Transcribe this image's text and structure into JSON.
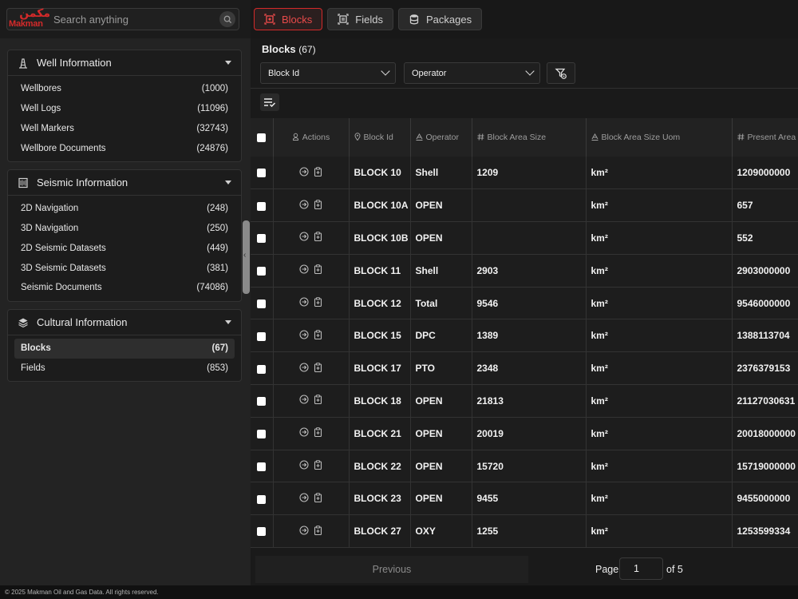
{
  "brand": {
    "logo_ar": "مكمن",
    "logo_en": "Makman"
  },
  "search": {
    "placeholder": "Search anything"
  },
  "tabs": [
    {
      "label": "Blocks",
      "icon": "block-icon",
      "active": true
    },
    {
      "label": "Fields",
      "icon": "fields-icon",
      "active": false
    },
    {
      "label": "Packages",
      "icon": "database-icon",
      "active": false
    }
  ],
  "sidebar": {
    "well": {
      "title": "Well Information",
      "items": [
        {
          "label": "Wellbores",
          "count": "(1000)"
        },
        {
          "label": "Well Logs",
          "count": "(11096)"
        },
        {
          "label": "Well Markers",
          "count": "(32743)"
        },
        {
          "label": "Wellbore Documents",
          "count": "(24876)"
        }
      ]
    },
    "seismic": {
      "title": "Seismic Information",
      "items": [
        {
          "label": "2D Navigation",
          "count": "(248)"
        },
        {
          "label": "3D Navigation",
          "count": "(250)"
        },
        {
          "label": "2D Seismic Datasets",
          "count": "(449)"
        },
        {
          "label": "3D Seismic Datasets",
          "count": "(381)"
        },
        {
          "label": "Seismic Documents",
          "count": "(74086)"
        }
      ]
    },
    "cultural": {
      "title": "Cultural Information",
      "items": [
        {
          "label": "Blocks",
          "count": "(67)",
          "active": true
        },
        {
          "label": "Fields",
          "count": "(853)"
        }
      ]
    }
  },
  "main": {
    "title": "Blocks",
    "count": "(67)",
    "filters": {
      "block_id": "Block Id",
      "operator": "Operator"
    }
  },
  "table": {
    "headers": {
      "actions": "Actions",
      "block_id": "Block Id",
      "operator": "Operator",
      "block_area_size": "Block Area Size",
      "block_area_size_uom": "Block Area Size Uom",
      "present_area_size": "Present Area Si"
    },
    "rows": [
      {
        "block_id": "BLOCK 10",
        "operator": "Shell",
        "area": "1209",
        "uom": "km²",
        "present": "1209000000"
      },
      {
        "block_id": "BLOCK 10A",
        "operator": "OPEN",
        "area": "",
        "uom": "km²",
        "present": "657"
      },
      {
        "block_id": "BLOCK 10B",
        "operator": "OPEN",
        "area": "",
        "uom": "km²",
        "present": "552"
      },
      {
        "block_id": "BLOCK 11",
        "operator": "Shell",
        "area": "2903",
        "uom": "km²",
        "present": "2903000000"
      },
      {
        "block_id": "BLOCK 12",
        "operator": "Total",
        "area": "9546",
        "uom": "km²",
        "present": "9546000000"
      },
      {
        "block_id": "BLOCK 15",
        "operator": "DPC",
        "area": "1389",
        "uom": "km²",
        "present": "1388113704"
      },
      {
        "block_id": "BLOCK 17",
        "operator": "PTO",
        "area": "2348",
        "uom": "km²",
        "present": "2376379153"
      },
      {
        "block_id": "BLOCK 18",
        "operator": "OPEN",
        "area": "21813",
        "uom": "km²",
        "present": "21127030631"
      },
      {
        "block_id": "BLOCK 21",
        "operator": "OPEN",
        "area": "20019",
        "uom": "km²",
        "present": "20018000000"
      },
      {
        "block_id": "BLOCK 22",
        "operator": "OPEN",
        "area": "15720",
        "uom": "km²",
        "present": "15719000000"
      },
      {
        "block_id": "BLOCK 23",
        "operator": "OPEN",
        "area": "9455",
        "uom": "km²",
        "present": "9455000000"
      },
      {
        "block_id": "BLOCK 27",
        "operator": "OXY",
        "area": "1255",
        "uom": "km²",
        "present": "1253599334"
      }
    ]
  },
  "pagination": {
    "previous": "Previous",
    "page_label": "Page",
    "current_page": "1",
    "of_label": "of 5"
  },
  "footer": {
    "text": "© 2025 Makman Oil and Gas Data. All rights reserved."
  },
  "colors": {
    "accent": "#d42a2a",
    "background": "#181818"
  }
}
